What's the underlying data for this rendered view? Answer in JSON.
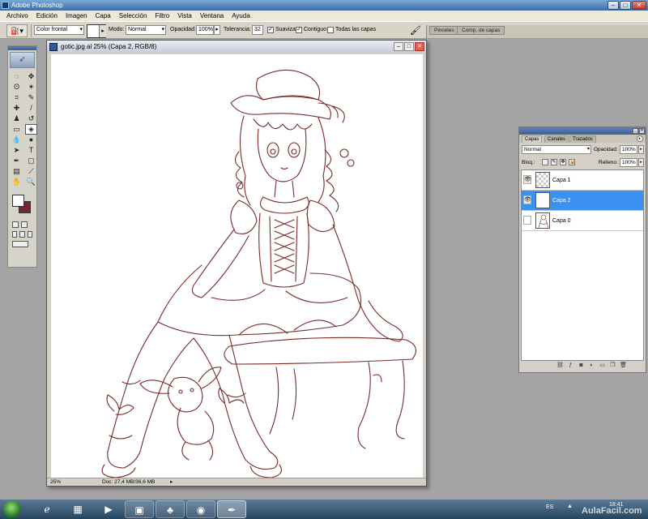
{
  "window": {
    "title": "Adobe Photoshop"
  },
  "menu": [
    "Archivo",
    "Edición",
    "Imagen",
    "Capa",
    "Selección",
    "Filtro",
    "Vista",
    "Ventana",
    "Ayuda"
  ],
  "options": {
    "fill_source": "Color frontal",
    "mode_label": "Modo:",
    "mode_value": "Normal",
    "opacity_label": "Opacidad:",
    "opacity_value": "100%",
    "tolerance_label": "Tolerancia:",
    "tolerance_value": "32",
    "antialias_label": "Suavizar",
    "antialias_checked": true,
    "contiguous_label": "Contiguo",
    "contiguous_checked": true,
    "all_layers_label": "Todas las capas",
    "all_layers_checked": false,
    "well_tabs": [
      "Pinceles",
      "Comp. de capas"
    ]
  },
  "toolbox": {
    "foreground_color": "#ffffff",
    "background_color": "#6e2a2c"
  },
  "document": {
    "title": "gotic.jpg al 25% (Capa 2, RGB/8)",
    "zoom": "25%",
    "doc_size": "Doc: 27,4 MB/36,6 MB"
  },
  "layers_panel": {
    "tabs": [
      "Capas",
      "Canales",
      "Trazados"
    ],
    "blend_mode": "Normal",
    "opacity_label": "Opacidad:",
    "opacity_value": "100%",
    "lock_label": "Bloq.:",
    "fill_label": "Relleno:",
    "fill_value": "100%",
    "layers": [
      {
        "name": "Capa 1",
        "visible": true,
        "selected": false,
        "thumb": "transparent"
      },
      {
        "name": "Capa 2",
        "visible": true,
        "selected": true,
        "thumb": "white"
      },
      {
        "name": "Capa 0",
        "visible": false,
        "selected": false,
        "thumb": "drawing"
      }
    ],
    "selected_color": "#3a91f0"
  },
  "taskbar": {
    "language": "ES",
    "time": "18:41",
    "watermark": "AulaFacil.com"
  },
  "colors": {
    "line_art": "#7a2a2a",
    "accent": "#3a91f0"
  }
}
